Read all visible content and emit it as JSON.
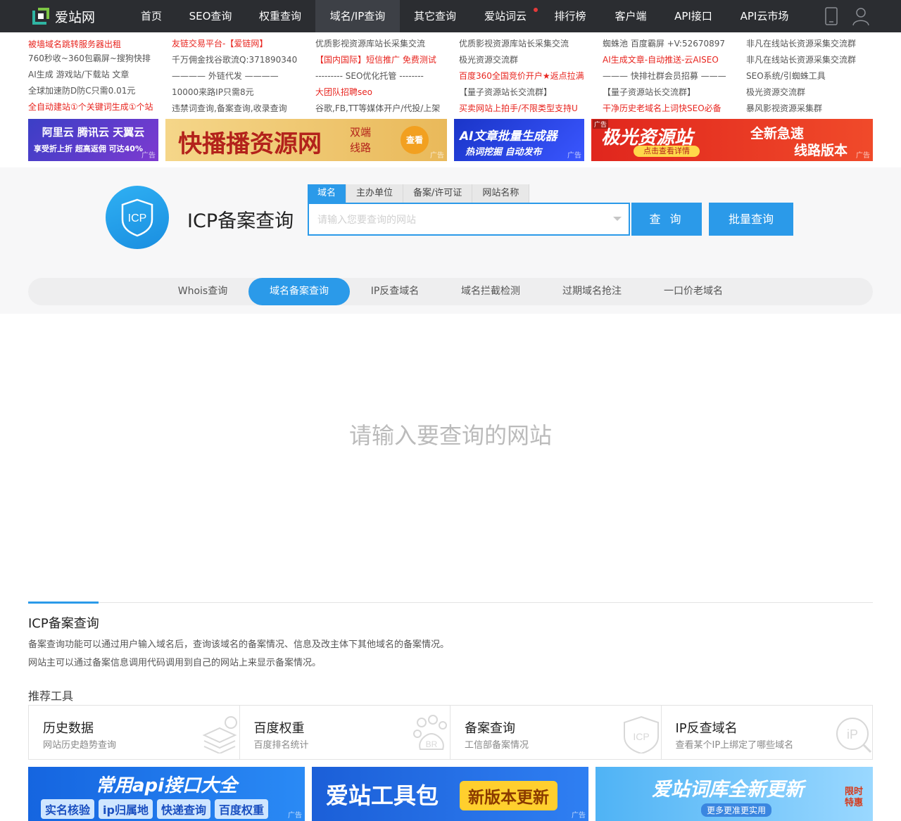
{
  "nav": {
    "logo_text": "爱站网",
    "items": [
      {
        "label": "首页"
      },
      {
        "label": "SEO查询"
      },
      {
        "label": "权重查询"
      },
      {
        "label": "域名/IP查询"
      },
      {
        "label": "其它查询"
      },
      {
        "label": "爱站词云"
      },
      {
        "label": "排行榜"
      },
      {
        "label": "客户端"
      },
      {
        "label": "API接口"
      },
      {
        "label": "API云市场"
      }
    ]
  },
  "ads": [
    [
      "被墙域名跳转服务器出租",
      "760秒收~360包霸屏~搜狗快排",
      "AI生成 游戏站/下载站 文章",
      "全球加速防D防C只需0.01元",
      "全自动建站①个关键词生成①个站"
    ],
    [
      "友链交易平台-【爱链网】",
      "千万佣金找谷歌流Q:371890340",
      "———— 外链代发 ————",
      "10000来路IP只需8元",
      "违禁词查询,备案查询,收录查询"
    ],
    [
      "优质影视资源库站长采集交流",
      "【国内国际】短信推广 免费测试",
      "--------- SEO优化托管 --------",
      "大团队招聘seo",
      "谷歌,FB,TT等媒体开户/代投/上架"
    ],
    [
      "优质影视资源库站长采集交流",
      "极光资源交流群",
      "百度360全国竞价开户★返点拉满",
      "【量子资源站长交流群】",
      "买卖网站上拍手/不限类型支持U"
    ],
    [
      "蜘蛛池 百度霸屏 +V:52670897",
      "AI生成文章-自动推送-云AISEO",
      "——— 快排社群会员招募 ———",
      "【量子资源站长交流群】",
      "干净历史老域名上词快SEO必备"
    ],
    [
      "非凡在线站长资源采集交流群",
      "非凡在线站长资源采集交流群",
      "SEO系统/引蜘蛛工具",
      "极光资源交流群",
      "暴风影视资源采集群"
    ]
  ],
  "banners": {
    "b1_line1": "阿里云 腾讯云 天翼云",
    "b1_line2": "享受折上折 超高返佣 可达40%",
    "b2_title": "快播播资源网",
    "b2_side": "双端 线路",
    "b2_btn": "查看",
    "b3_line1": "AI文章批量生成器",
    "b3_line2": "热词挖掘 自动发布",
    "b4_title": "极光资源站",
    "b4_side1": "全新急速",
    "b4_side2": "线路版本",
    "b4_btn": "点击查看详情",
    "ad_tag": "广告",
    "ad_badge": "广告"
  },
  "icp": {
    "logo_text": "ICP",
    "title": "ICP备案查询",
    "tabs": [
      "域名",
      "主办单位",
      "备案/许可证",
      "网站名称"
    ],
    "placeholder": "请输入您要查询的网站",
    "query_btn": "查 询",
    "batch_btn": "批量查询"
  },
  "subnav": [
    "Whois查询",
    "域名备案查询",
    "IP反查域名",
    "域名拦截检测",
    "过期域名抢注",
    "一口价老域名"
  ],
  "empty_msg": "请输入要查询的网站",
  "info": {
    "title": "ICP备案查询",
    "desc1": "备案查询功能可以通过用户输入域名后，查询该域名的备案情况、信息及改主体下其他域名的备案情况。",
    "desc2": "网站主可以通过备案信息调用代码调用到自己的网站上来显示备案情况。",
    "rec_title": "推荐工具"
  },
  "tools": [
    {
      "name": "历史数据",
      "desc": "网站历史趋势查询"
    },
    {
      "name": "百度权重",
      "desc": "百度排名统计",
      "icon_text": "BR"
    },
    {
      "name": "备案查询",
      "desc": "工信部备案情况",
      "icon_text": "ICP"
    },
    {
      "name": "IP反查域名",
      "desc": "查看某个IP上绑定了哪些域名",
      "icon_text": "iP"
    }
  ],
  "bottom_banners": {
    "bb1_title": "常用api接口大全",
    "bb1_tags": [
      "实名核验",
      "ip归属地",
      "快递查询",
      "百度权重"
    ],
    "bb2_title": "爱站工具包",
    "bb2_badge": "新版本更新",
    "bb3_title": "爱站词库全新更新",
    "bb3_sub": "更多更准更实用",
    "bb3_badge": "限时特惠"
  },
  "colors": {
    "accent": "#2b9ae9",
    "nav_bg": "#2b2d31",
    "ad_red": "#e8251f"
  }
}
